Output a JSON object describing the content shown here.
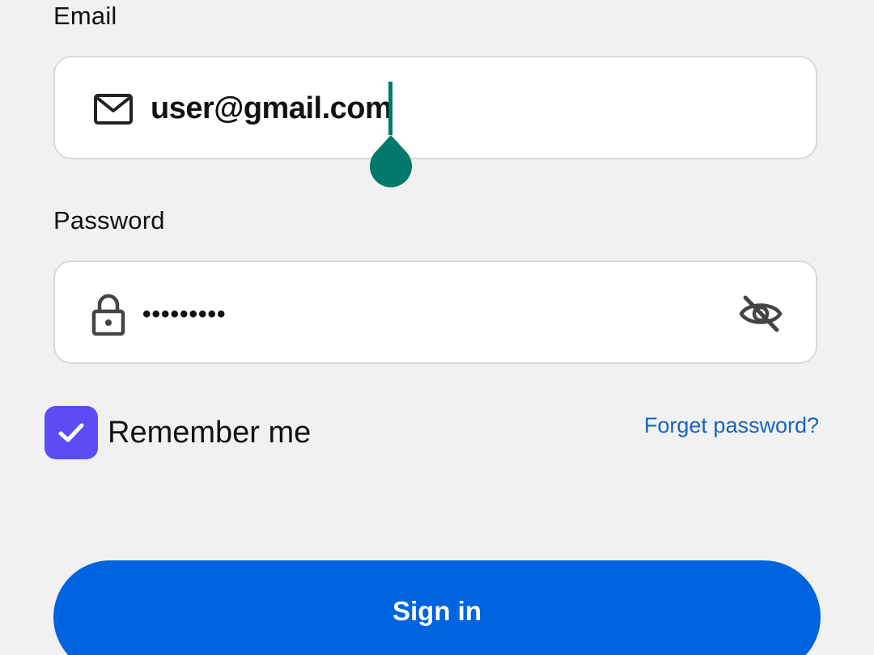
{
  "email": {
    "label": "Email",
    "value": "user@gmail.com",
    "icon": "mail-icon"
  },
  "password": {
    "label": "Password",
    "masked_value": "•••••••••",
    "icon": "lock-icon",
    "toggle_icon": "eye-off-icon"
  },
  "remember": {
    "label": "Remember me",
    "checked": true
  },
  "forgot_link": "Forget password?",
  "signin_button": "Sign in",
  "colors": {
    "background": "#f1f1f1",
    "checkbox": "#5b4cf5",
    "link": "#1565c0",
    "primary_button": "#0064e0",
    "text_cursor": "#00796b"
  }
}
